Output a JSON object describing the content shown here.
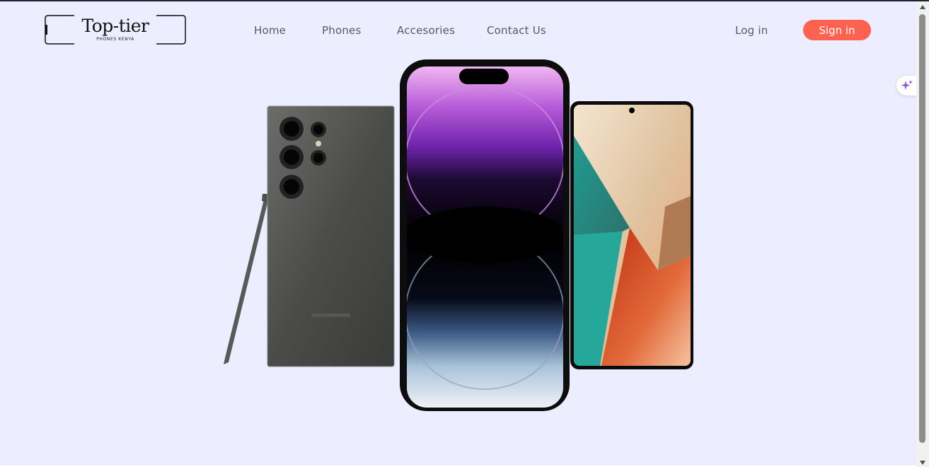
{
  "brand": {
    "name": "Top-tier",
    "tagline": "PHONES KENYA"
  },
  "nav": {
    "items": [
      {
        "label": "Home"
      },
      {
        "label": "Phones"
      },
      {
        "label": "Accesories"
      },
      {
        "label": "Contact Us"
      }
    ]
  },
  "auth": {
    "login_label": "Log in",
    "signin_label": "Sign in"
  },
  "colors": {
    "background": "#ecedfe",
    "accent": "#fd614f",
    "nav_text": "#555a66"
  },
  "icons": {
    "ai_badge": "sparkle-icon",
    "scroll_up": "arrow-up-icon",
    "scroll_down": "arrow-down-icon"
  },
  "hero": {
    "product_images": [
      "samsung-galaxy-s24-ultra",
      "iphone-14-pro",
      "redmi-note-13"
    ]
  }
}
